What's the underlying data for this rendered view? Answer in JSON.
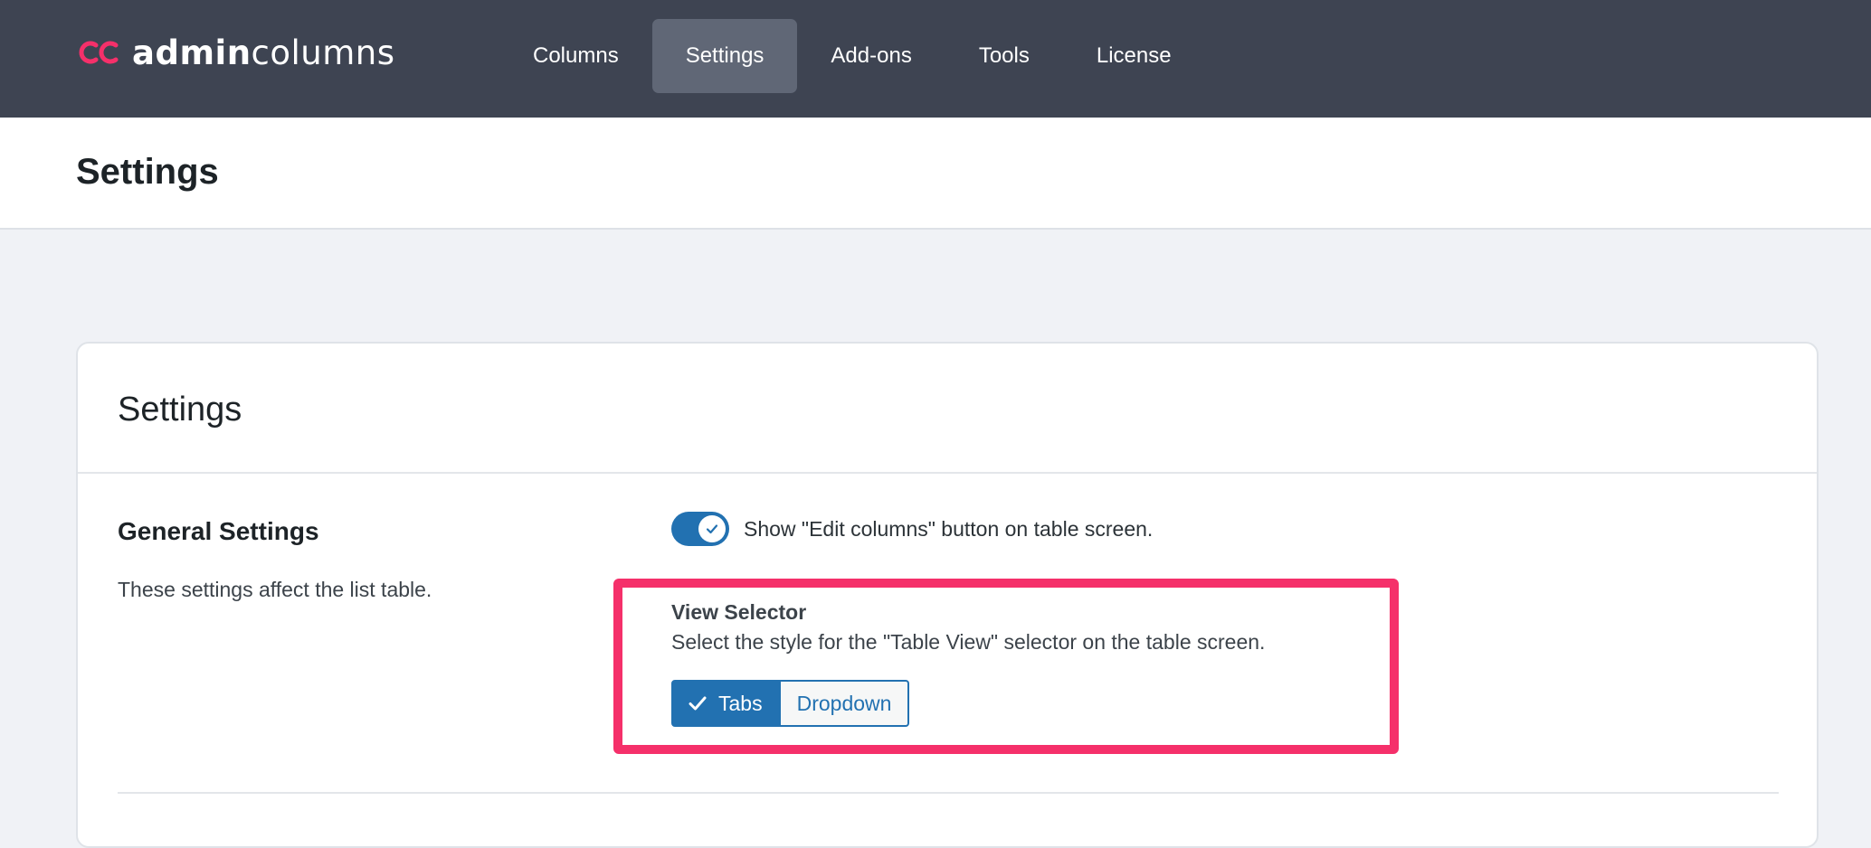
{
  "brand": {
    "name_bold": "admin",
    "name_light": "columns",
    "accent_color": "#f5306a"
  },
  "nav": {
    "items": [
      {
        "label": "Columns",
        "active": false
      },
      {
        "label": "Settings",
        "active": true
      },
      {
        "label": "Add-ons",
        "active": false
      },
      {
        "label": "Tools",
        "active": false
      },
      {
        "label": "License",
        "active": false
      }
    ]
  },
  "page": {
    "title": "Settings"
  },
  "card": {
    "title": "Settings",
    "section": {
      "title": "General Settings",
      "description": "These settings affect the list table."
    },
    "edit_columns_toggle": {
      "label": "Show \"Edit columns\" button on table screen.",
      "checked": true
    },
    "view_selector": {
      "title": "View Selector",
      "description": "Select the style for the \"Table View\" selector on the table screen.",
      "options": [
        {
          "label": "Tabs",
          "selected": true
        },
        {
          "label": "Dropdown",
          "selected": false
        }
      ]
    }
  },
  "colors": {
    "topbar": "#3e4452",
    "nav_active": "#606776",
    "primary": "#2271b1",
    "highlight": "#f5306a"
  },
  "icons": {
    "logo": "admin-columns-logo-icon",
    "toggle_check": "check-icon",
    "tabs_check": "check-icon"
  }
}
